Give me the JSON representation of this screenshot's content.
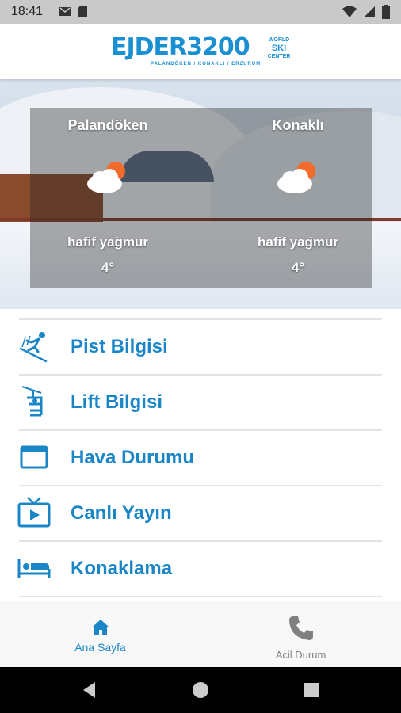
{
  "status_bar": {
    "time": "18:41",
    "left_icons": [
      "gmail-icon",
      "sd-card-icon"
    ],
    "right_icons": [
      "wifi-icon",
      "signal-icon",
      "battery-icon"
    ]
  },
  "header": {
    "logo_main": "EJDER3200",
    "logo_side": [
      "WORLD",
      "SKI",
      "CENTER"
    ],
    "logo_sub": "PALANDÖKEN / KONAKLI / ERZURUM"
  },
  "weather": [
    {
      "city": "Palandöken",
      "icon": "partly-cloudy-rain-icon",
      "description": "hafif yağmur",
      "temperature": "4°"
    },
    {
      "city": "Konaklı",
      "icon": "partly-cloudy-rain-icon",
      "description": "hafif yağmur",
      "temperature": "4°"
    }
  ],
  "menu": {
    "items": [
      {
        "label": "Pist Bilgisi",
        "icon": "skier-icon"
      },
      {
        "label": "Lift Bilgisi",
        "icon": "chairlift-icon"
      },
      {
        "label": "Hava Durumu",
        "icon": "window-icon"
      },
      {
        "label": "Canlı Yayın",
        "icon": "live-tv-icon"
      },
      {
        "label": "Konaklama",
        "icon": "bed-icon"
      }
    ]
  },
  "bottom_nav": {
    "home_label": "Ana Sayfa",
    "emergency_label": "Acil Durum",
    "active": "Ana Sayfa"
  },
  "colors": {
    "accent": "#1a86c8",
    "status_bar": "#c9c9c9",
    "inactive": "#808080"
  }
}
